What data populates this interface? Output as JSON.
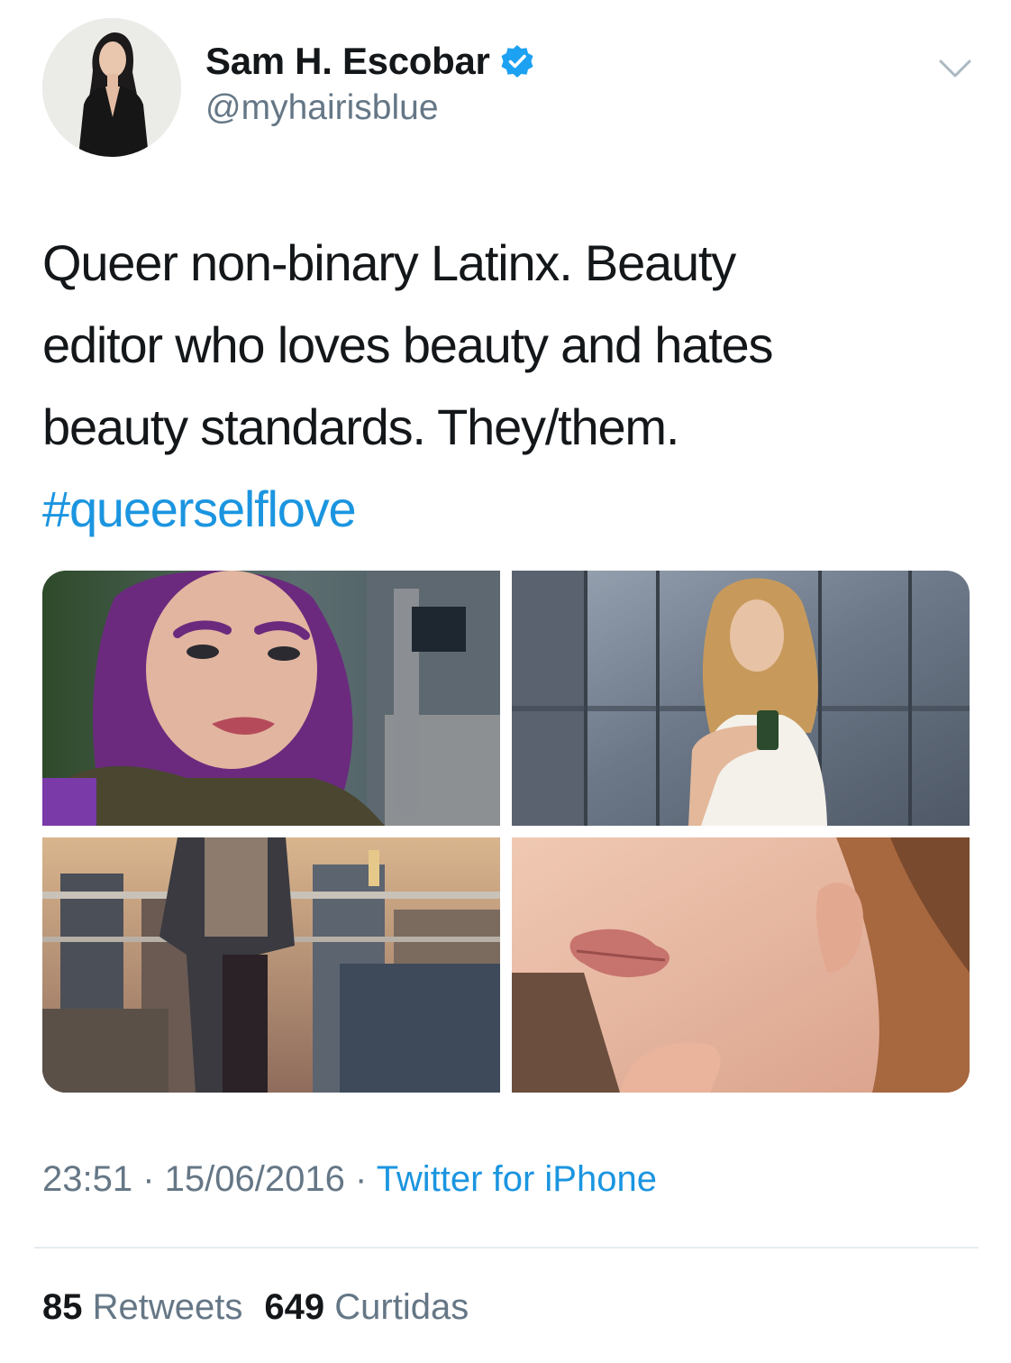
{
  "tweet": {
    "author": {
      "display_name": "Sam H. Escobar",
      "handle": "@myhairisblue",
      "verified": true
    },
    "text_lines": [
      "Queer non-binary Latinx. Beauty",
      "editor who loves beauty and hates",
      "beauty standards. They/them."
    ],
    "hashtag": "#queerselflove",
    "media": [
      {
        "icon": "photo-selfie-purple-hair"
      },
      {
        "icon": "photo-elevator-mirror-selfie"
      },
      {
        "icon": "photo-rooftop-city-view"
      },
      {
        "icon": "photo-lips-closeup"
      }
    ],
    "time": "23:51",
    "separator": " · ",
    "date": "15/06/2016",
    "source": "Twitter for iPhone",
    "stats": {
      "retweets_count": "85",
      "retweets_label": "Retweets",
      "likes_count": "649",
      "likes_label": "Curtidas"
    }
  },
  "colors": {
    "link": "#1b95e0",
    "secondary_text": "#657786",
    "primary_text": "#14171a",
    "divider": "#e6ecf0"
  }
}
